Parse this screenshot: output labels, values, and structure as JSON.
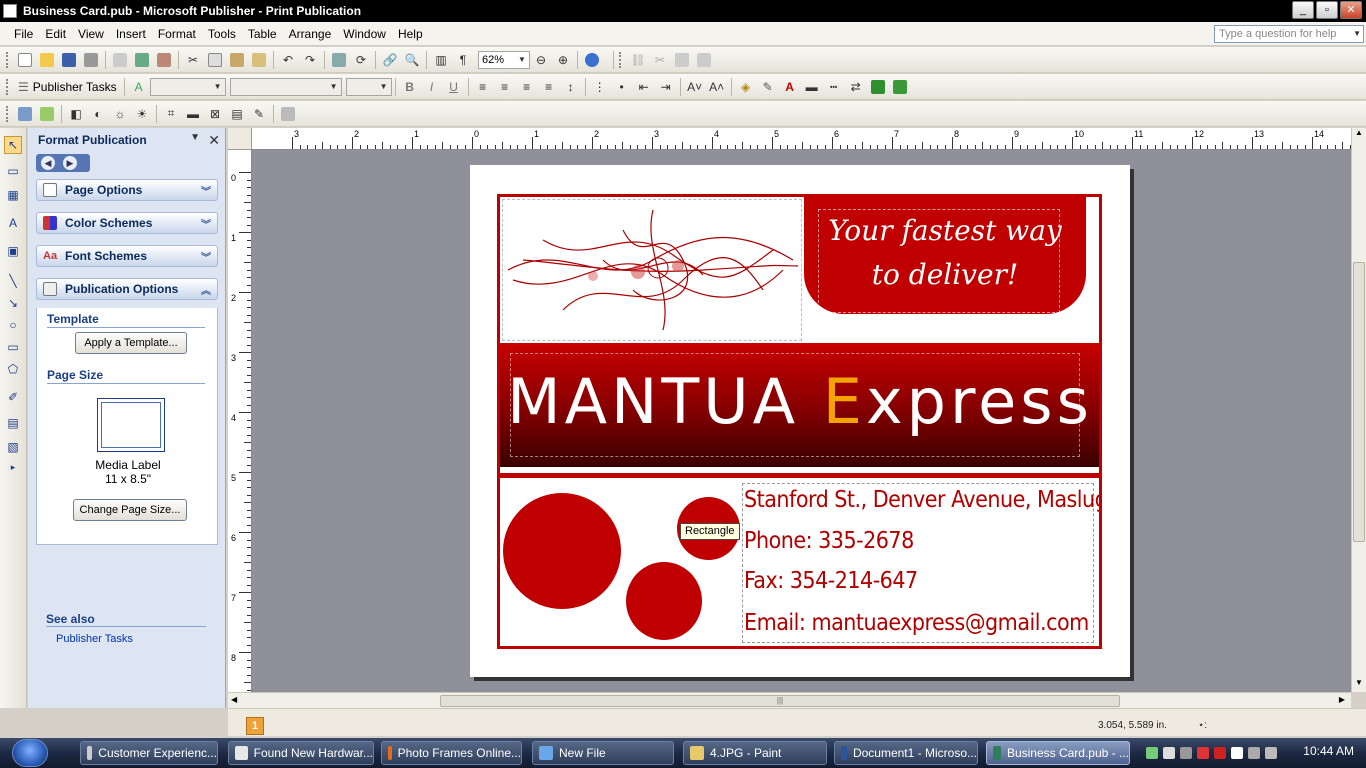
{
  "window": {
    "title": "Business Card.pub - Microsoft Publisher - Print Publication",
    "btn_min": "_",
    "btn_max": "▫",
    "btn_close": "✕"
  },
  "menu": {
    "items": [
      "File",
      "Edit",
      "View",
      "Insert",
      "Format",
      "Tools",
      "Table",
      "Arrange",
      "Window",
      "Help"
    ],
    "help_placeholder": "Type a question for help"
  },
  "toolbar": {
    "zoom": "62%",
    "publisher_tasks": "Publisher Tasks",
    "bold": "B",
    "italic": "I",
    "underline": "U"
  },
  "taskpane": {
    "title": "Format Publication",
    "sections": [
      "Page Options",
      "Color Schemes",
      "Font Schemes",
      "Publication Options"
    ],
    "template_label": "Template",
    "apply_template_button": "Apply a Template...",
    "page_size_label": "Page Size",
    "page_size_name": "Media Label",
    "page_size_dims": "11 x 8.5\"",
    "change_page_size_button": "Change Page Size...",
    "see_also_label": "See also",
    "publisher_tasks_link": "Publisher Tasks"
  },
  "rulers": {
    "h_labels": [
      "3",
      "2",
      "1",
      "0",
      "1",
      "2",
      "3",
      "4",
      "5",
      "6",
      "7",
      "8",
      "9",
      "10",
      "11",
      "12",
      "13",
      "14"
    ],
    "v_labels": [
      "0",
      "1",
      "2",
      "3",
      "4",
      "5",
      "6",
      "7",
      "8"
    ]
  },
  "card": {
    "tagline_line1": "Your fastest way",
    "tagline_line2": "to deliver!",
    "brand_part1": "MANTUA ",
    "brand_e": "E",
    "brand_part2": "xpress",
    "address": "Stanford St., Denver Avenue, Maslug City",
    "phone": "Phone: 335-2678",
    "fax": "Fax: 354-214-647",
    "email": "Email: mantuaexpress@gmail.com",
    "tooltip": "Rectangle"
  },
  "status": {
    "page": "1",
    "coords": "3.054, 5.589 in."
  },
  "taskbar": {
    "tasks": [
      "Customer Experienc...",
      "Found New Hardwar...",
      "Photo Frames Online...",
      "New File",
      "4.JPG - Paint",
      "Document1 - Microso...",
      "Business Card.pub - ..."
    ],
    "clock": "10:44 AM"
  },
  "colors": {
    "brand_red": "#c00000",
    "brand_orange": "#f5a300",
    "pane_bg": "#dde5f2"
  }
}
